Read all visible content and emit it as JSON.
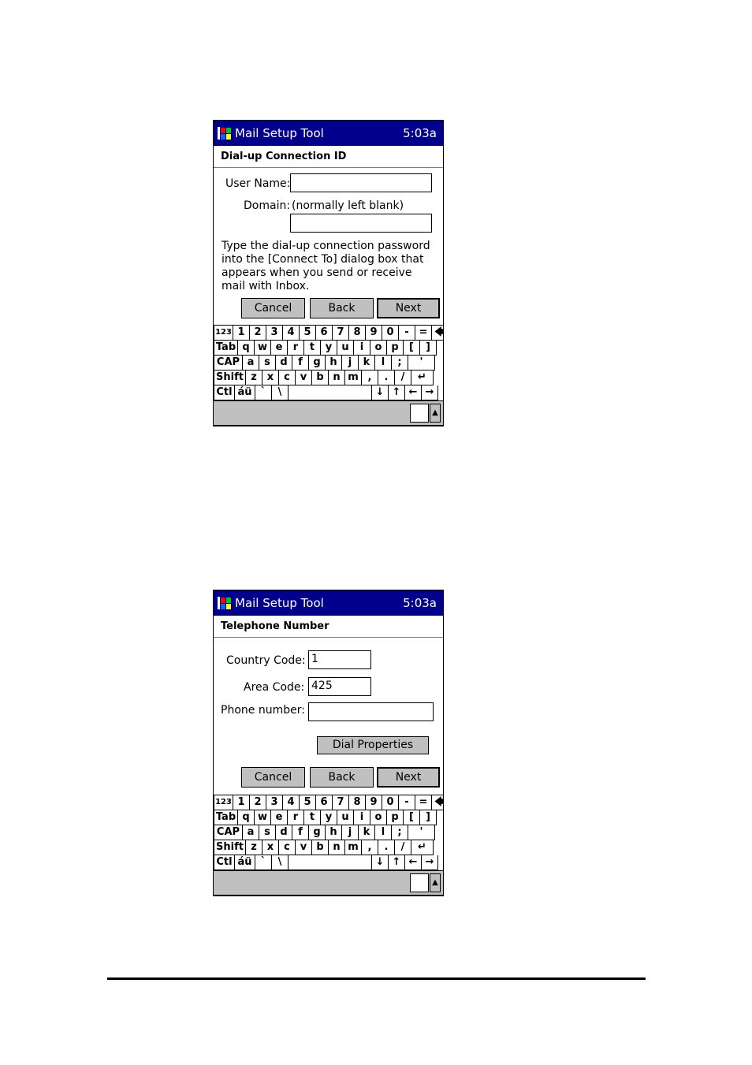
{
  "screens": [
    {
      "titlebar": {
        "title": "Mail Setup Tool",
        "time": "5:03a",
        "logo_icon": "windows-flag-icon"
      },
      "header": "Dial-up Connection ID",
      "labels": {
        "user_name": "User Name:",
        "domain": "Domain:",
        "domain_hint": "(normally left blank)"
      },
      "fields": {
        "user_name": "",
        "domain": ""
      },
      "instruction": "Type the dial-up connection password into the [Connect To] dialog box that appears when you send or receive mail with Inbox.",
      "buttons": {
        "cancel": "Cancel",
        "back": "Back",
        "next": "Next"
      }
    },
    {
      "titlebar": {
        "title": "Mail Setup Tool",
        "time": "5:03a",
        "logo_icon": "windows-flag-icon"
      },
      "header": "Telephone Number",
      "labels": {
        "country_code": "Country Code:",
        "area_code": "Area Code:",
        "phone_number": "Phone number:"
      },
      "fields": {
        "country_code": "1",
        "area_code": "425",
        "phone_number": ""
      },
      "buttons": {
        "dial_properties": "Dial Properties",
        "cancel": "Cancel",
        "back": "Back",
        "next": "Next"
      }
    }
  ],
  "keyboard": {
    "rows": [
      [
        "123",
        "1",
        "2",
        "3",
        "4",
        "5",
        "6",
        "7",
        "8",
        "9",
        "0",
        "-",
        "=",
        "🡄"
      ],
      [
        "Tab",
        "q",
        "w",
        "e",
        "r",
        "t",
        "y",
        "u",
        "i",
        "o",
        "p",
        "[",
        "]"
      ],
      [
        "CAP",
        "a",
        "s",
        "d",
        "f",
        "g",
        "h",
        "j",
        "k",
        "l",
        ";",
        "'"
      ],
      [
        "Shift",
        "z",
        "x",
        "c",
        "v",
        "b",
        "n",
        "m",
        ",",
        ".",
        "/",
        "↵"
      ],
      [
        "Ctl",
        "áü",
        "`",
        "\\",
        " ",
        "↓",
        "↑",
        "←",
        "→"
      ]
    ]
  },
  "statusbar": {
    "sip_icon": "keyboard-icon",
    "sip_menu_icon": "triangle-up-icon",
    "sip_arrow": "▲"
  }
}
